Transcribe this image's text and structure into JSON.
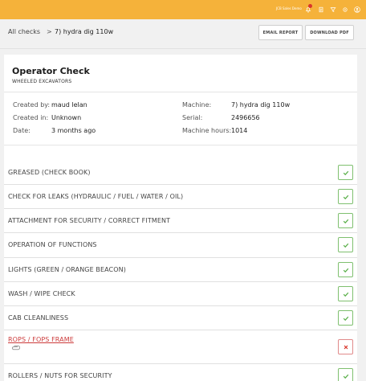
{
  "topbar": {
    "user": "JCB Sales Demo",
    "icons": [
      "notifications-icon",
      "document-icon",
      "filter-icon",
      "settings-icon",
      "account-icon"
    ]
  },
  "breadcrumb": {
    "root": "All checks",
    "separator": ">",
    "current": "7) hydra dig 110w"
  },
  "actions": {
    "email": "EMAIL REPORT",
    "pdf": "DOWNLOAD PDF"
  },
  "check": {
    "title": "Operator Check",
    "subtitle": "WHEELED EXCAVATORS"
  },
  "meta": {
    "created_by_label": "Created by:",
    "created_by": "maud lelan",
    "created_in_label": "Created in:",
    "created_in": "Unknown",
    "date_label": "Date:",
    "date": "3 months ago",
    "machine_label": "Machine:",
    "machine": "7) hydra dig 110w",
    "serial_label": "Serial:",
    "serial": "2496656",
    "hours_label": "Machine hours:",
    "hours": "1014"
  },
  "items": [
    {
      "label": "GREASED (CHECK BOOK)",
      "status": "pass"
    },
    {
      "label": "CHECK FOR LEAKS (HYDRAULIC / FUEL / WATER / OIL)",
      "status": "pass"
    },
    {
      "label": "ATTACHMENT FOR SECURITY / CORRECT FITMENT",
      "status": "pass"
    },
    {
      "label": "OPERATION OF FUNCTIONS",
      "status": "pass"
    },
    {
      "label": "LIGHTS (GREEN / ORANGE BEACON)",
      "status": "pass"
    },
    {
      "label": "WASH / WIPE CHECK",
      "status": "pass"
    },
    {
      "label": "CAB CLEANLINESS",
      "status": "pass"
    },
    {
      "label": "ROPS / FOPS FRAME",
      "status": "fail"
    },
    {
      "label": "ROLLERS / NUTS FOR SECURITY",
      "status": "pass"
    }
  ],
  "colors": {
    "topbar": "#f5b23a",
    "pass": "#5bb04a",
    "fail": "#d9352b"
  }
}
